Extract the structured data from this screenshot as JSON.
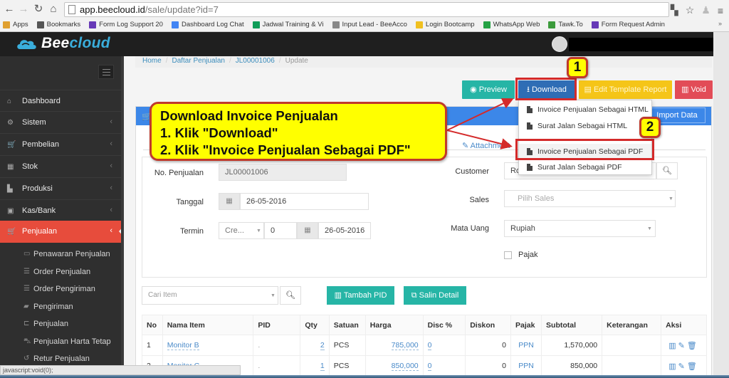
{
  "browser": {
    "url_host": "app.beecloud.id",
    "url_path": "/sale/update?id=7",
    "bookmarks": [
      {
        "label": "Apps",
        "icon": "apps-grid-icon",
        "color": "#e0a030"
      },
      {
        "label": "Bookmarks",
        "icon": "star-icon",
        "color": "#555555"
      },
      {
        "label": "Form Log Support 20",
        "icon": "form-icon",
        "color": "#673ab7"
      },
      {
        "label": "Dashboard Log Chat",
        "icon": "google-icon",
        "color": "#4285f4"
      },
      {
        "label": "Jadwal Training & Vi",
        "icon": "sheets-icon",
        "color": "#0f9d58"
      },
      {
        "label": "Input Lead - BeeAcco",
        "icon": "page-icon",
        "color": "#888888"
      },
      {
        "label": "Login Bootcamp",
        "icon": "bee-icon",
        "color": "#f0c020"
      },
      {
        "label": "WhatsApp Web",
        "icon": "whatsapp-icon",
        "color": "#25a244"
      },
      {
        "label": "Tawk.To",
        "icon": "tawk-icon",
        "color": "#3c9b3c"
      },
      {
        "label": "Form Request Admin",
        "icon": "form-icon",
        "color": "#673ab7"
      }
    ],
    "more": "»",
    "status_text": "javascript:void(0);"
  },
  "app": {
    "logo_part1": "Bee",
    "logo_part2": "cloud",
    "brand_color": "#3aaedc"
  },
  "sidebar": {
    "items": [
      {
        "label": "Dashboard",
        "icon": "home-icon",
        "glyph": "⌂",
        "has_chevron": false
      },
      {
        "label": "Sistem",
        "icon": "cogs-icon",
        "glyph": "⚙",
        "has_chevron": true
      },
      {
        "label": "Pembelian",
        "icon": "cart-icon",
        "glyph": "🛒",
        "has_chevron": true
      },
      {
        "label": "Stok",
        "icon": "box-icon",
        "glyph": "▦",
        "has_chevron": true
      },
      {
        "label": "Produksi",
        "icon": "industry-icon",
        "glyph": "▙",
        "has_chevron": true
      },
      {
        "label": "Kas/Bank",
        "icon": "money-icon",
        "glyph": "▣",
        "has_chevron": true
      },
      {
        "label": "Penjualan",
        "icon": "cart-icon",
        "glyph": "🛒",
        "has_chevron": true,
        "active": true
      }
    ],
    "chevron": "‹",
    "sub_items": [
      {
        "label": "Penawaran Penjualan",
        "icon": "credit-card-icon",
        "glyph": "▭"
      },
      {
        "label": "Order Penjualan",
        "icon": "list-icon",
        "glyph": "☰"
      },
      {
        "label": "Order Pengiriman",
        "icon": "list-ul-icon",
        "glyph": "☰"
      },
      {
        "label": "Pengiriman",
        "icon": "truck-icon",
        "glyph": "▰"
      },
      {
        "label": "Penjualan",
        "icon": "cart-icon",
        "glyph": "⊏"
      },
      {
        "label": "Penjualan Harta Tetap",
        "icon": "car-icon",
        "glyph": "⛍"
      },
      {
        "label": "Retur Penjualan",
        "icon": "undo-icon",
        "glyph": "↺"
      }
    ],
    "active_color": "#e74c3c"
  },
  "breadcrumb": [
    "Home",
    "Daftar Penjualan",
    "JL00001006",
    "Update"
  ],
  "actions": {
    "preview": "Preview",
    "download": "Download",
    "edit_template": "Edit Template Report",
    "void": "Void",
    "import_data": "Import Data",
    "attachment_tab": "Attachment"
  },
  "download_menu": [
    {
      "label": "Invoice Penjualan Sebagai HTML"
    },
    {
      "label": "Surat Jalan Sebagai HTML"
    },
    {
      "label": "Invoice Penjualan Sebagai PDF",
      "highlighted": true
    },
    {
      "label": "Surat Jalan Sebagai PDF"
    }
  ],
  "form": {
    "no_penjualan_label": "No. Penjualan",
    "no_penjualan_value": "JL00001006",
    "tanggal_label": "Tanggal",
    "tanggal_value": "26-05-2016",
    "termin_label": "Termin",
    "termin_type": "Cre...",
    "termin_days": "0",
    "termin_date": "26-05-2016",
    "customer_label": "Customer",
    "customer_value": "Ro",
    "sales_label": "Sales",
    "sales_placeholder": "Pilih Sales",
    "mata_uang_label": "Mata Uang",
    "mata_uang_value": "Rupiah",
    "pajak_label": "Pajak",
    "pajak_checked": false
  },
  "items_toolbar": {
    "search_placeholder": "Cari Item",
    "tambah_pid": "Tambah PID",
    "salin_detail": "Salin Detail"
  },
  "table": {
    "columns": [
      "No",
      "Nama Item",
      "PID",
      "Qty",
      "Satuan",
      "Harga",
      "Disc %",
      "Diskon",
      "Pajak",
      "Subtotal",
      "Keterangan",
      "Aksi"
    ],
    "rows": [
      {
        "no": "1",
        "nama": "Monitor B",
        "pid": ".",
        "qty": "2",
        "satuan": "PCS",
        "harga": "785,000",
        "disc": "0",
        "diskon": "0",
        "pajak": "PPN",
        "subtotal": "1,570,000",
        "keterangan": ""
      },
      {
        "no": "2",
        "nama": "Monitor C",
        "pid": ".",
        "qty": "1",
        "satuan": "PCS",
        "harga": "850,000",
        "disc": "0",
        "diskon": "0",
        "pajak": "PPN",
        "subtotal": "850,000",
        "keterangan": ""
      }
    ]
  },
  "annotation": {
    "title": "Download Invoice Penjualan",
    "step1": "1. Klik \"Download\"",
    "step2": "2. Klik \"Invoice Penjualan Sebagai PDF\"",
    "badge1": "1",
    "badge2": "2",
    "highlight_color": "#ffff00",
    "border_color": "#c0392b"
  }
}
